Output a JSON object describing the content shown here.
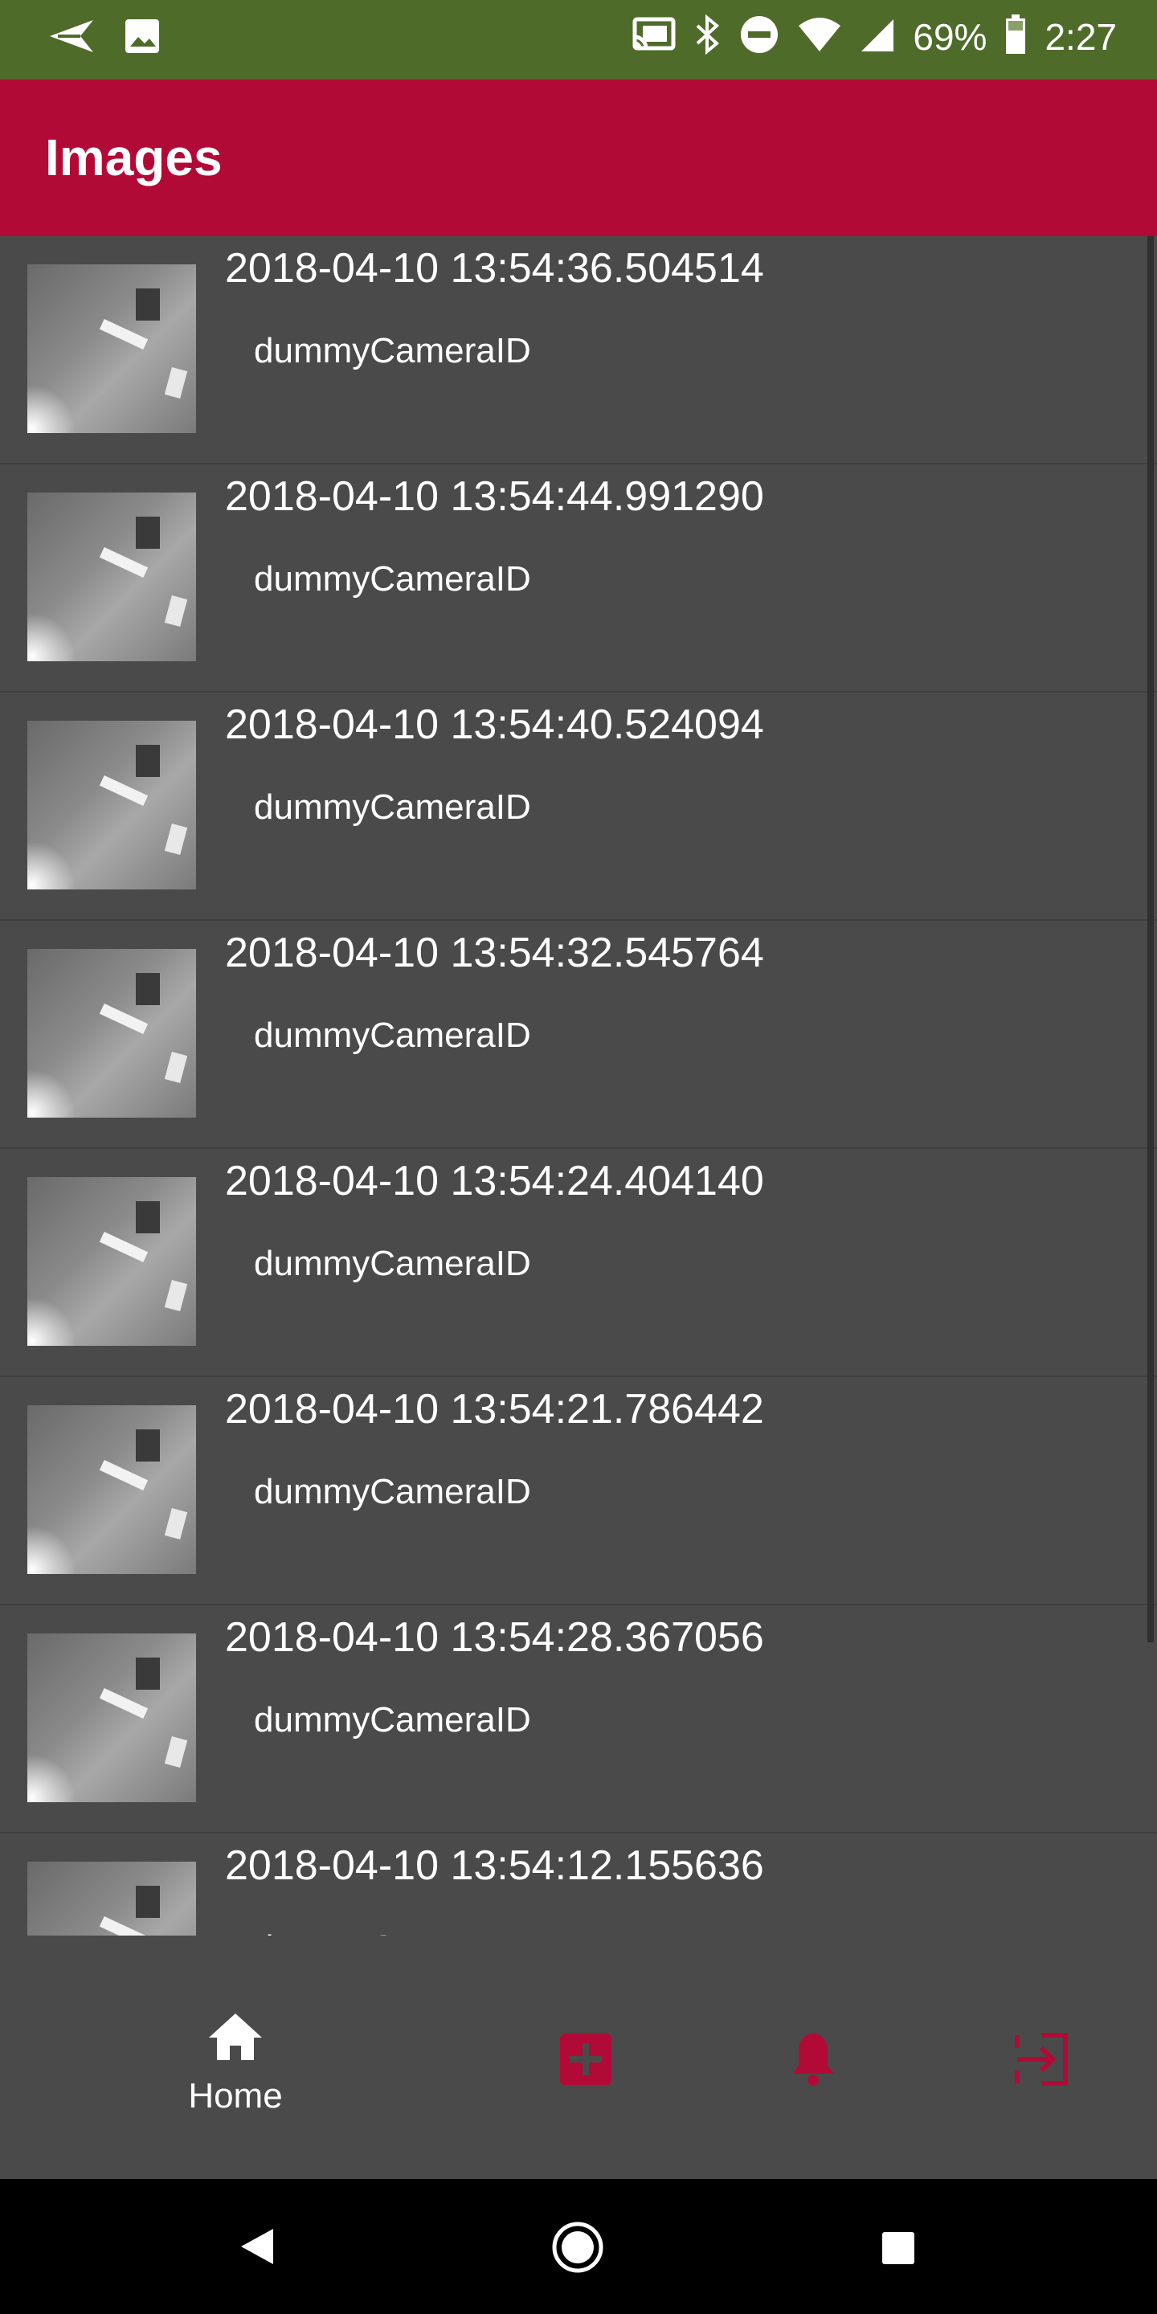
{
  "status_bar": {
    "battery": "69%",
    "time": "2:27"
  },
  "app_bar": {
    "title": "Images"
  },
  "images": [
    {
      "timestamp": "2018-04-10 13:54:36.504514",
      "camera": "dummyCameraID"
    },
    {
      "timestamp": "2018-04-10 13:54:44.991290",
      "camera": "dummyCameraID"
    },
    {
      "timestamp": "2018-04-10 13:54:40.524094",
      "camera": "dummyCameraID"
    },
    {
      "timestamp": "2018-04-10 13:54:32.545764",
      "camera": "dummyCameraID"
    },
    {
      "timestamp": "2018-04-10 13:54:24.404140",
      "camera": "dummyCameraID"
    },
    {
      "timestamp": "2018-04-10 13:54:21.786442",
      "camera": "dummyCameraID"
    },
    {
      "timestamp": "2018-04-10 13:54:28.367056",
      "camera": "dummyCameraID"
    },
    {
      "timestamp": "2018-04-10 13:54:12.155636",
      "camera": "dummyCameraID"
    }
  ],
  "bottom_nav": {
    "home_label": "Home",
    "items": [
      {
        "icon": "home-icon",
        "label": "Home",
        "active": true
      },
      {
        "icon": "add-box-icon"
      },
      {
        "icon": "bell-icon"
      },
      {
        "icon": "logout-icon"
      }
    ]
  },
  "colors": {
    "status_bar": "#4f6b2a",
    "app_bar": "#b20a37",
    "background": "#4a4a4a",
    "accent": "#b20a37"
  }
}
